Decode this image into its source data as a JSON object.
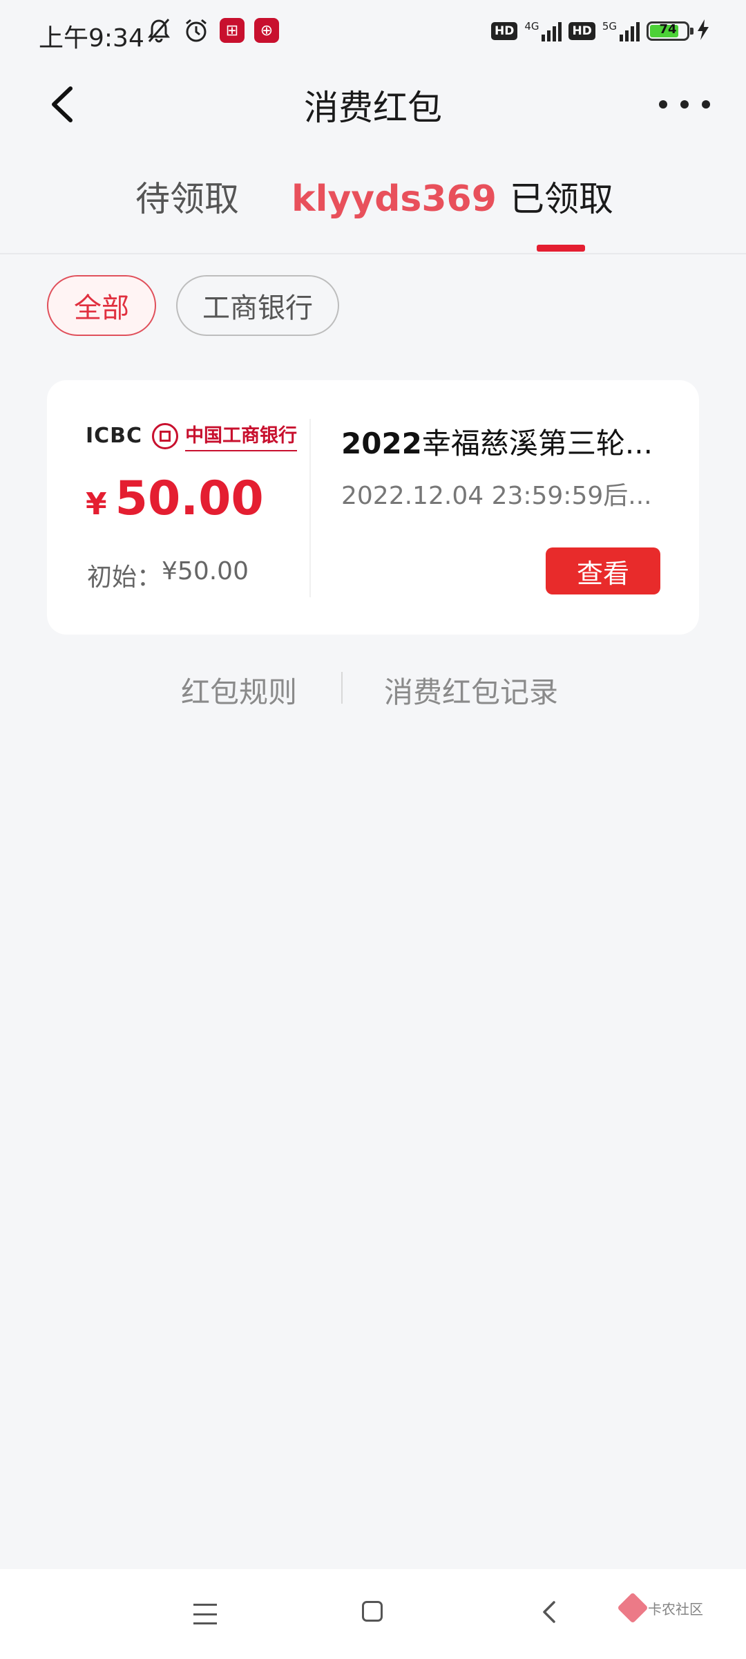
{
  "status_bar": {
    "time": "上午9:34",
    "left_icons": [
      "mute-bell-icon",
      "alarm-icon",
      "icbc-app-icon",
      "icbc-app-icon-2"
    ],
    "hd1": "HD",
    "net1": "4G",
    "hd2": "HD",
    "net2": "5G",
    "battery": "74"
  },
  "header": {
    "title": "消费红包"
  },
  "tabs": {
    "pending": "待领取",
    "watermark": "klyyds369",
    "received": "已领取",
    "active": "received"
  },
  "filters": {
    "all": "全部",
    "icbc": "工商银行",
    "selected": "all"
  },
  "coupon": {
    "bank_logo_en": "ICBC",
    "bank_logo_cn": "中国工商银行",
    "currency": "¥",
    "amount": "50.00",
    "initial_label": "初始：",
    "initial_value": "¥50.00",
    "title_bold": "2022",
    "title_rest": "幸福慈溪第三轮...",
    "expire": "2022.12.04 23:59:59后...",
    "view_button": "查看"
  },
  "links": {
    "rules": "红包规则",
    "record": "消费红包记录"
  },
  "watermark_corner": {
    "text": "卡农社区"
  },
  "colors": {
    "accent_red": "#e41e31",
    "background": "#f5f6f8",
    "card": "#ffffff"
  }
}
